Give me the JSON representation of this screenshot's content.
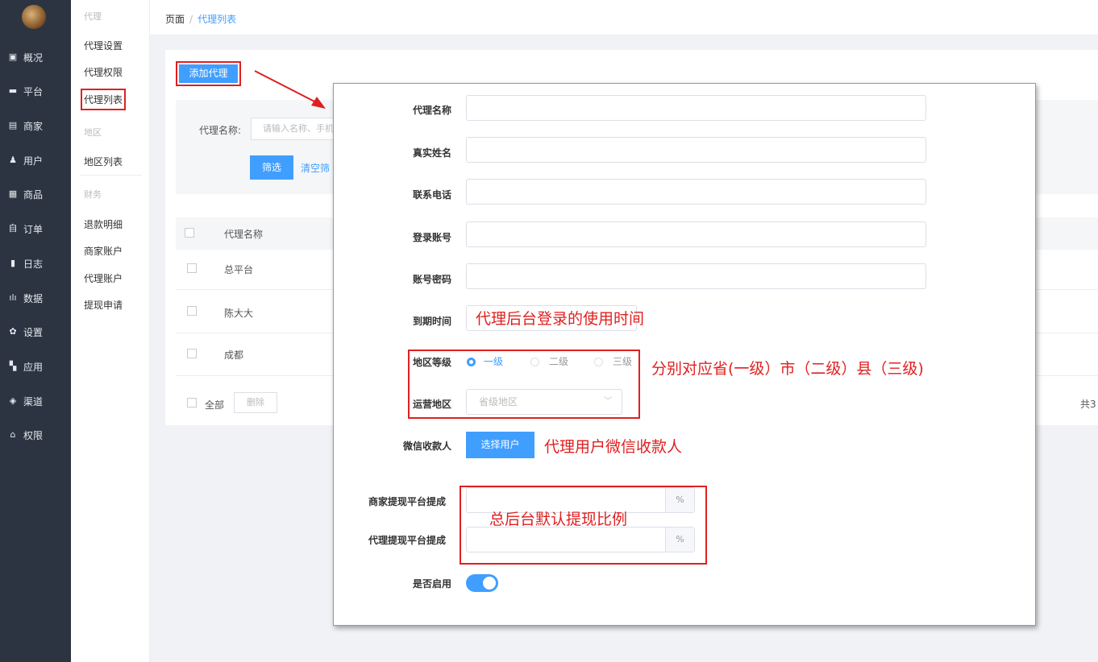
{
  "sidebar": {
    "items": [
      {
        "label": "概况",
        "icon": "monitor-icon",
        "glyph": "▣"
      },
      {
        "label": "平台",
        "icon": "platform-icon",
        "glyph": "▬"
      },
      {
        "label": "商家",
        "icon": "store-icon",
        "glyph": "▤"
      },
      {
        "label": "用户",
        "icon": "user-icon",
        "glyph": "♟"
      },
      {
        "label": "商品",
        "icon": "goods-icon",
        "glyph": "▦"
      },
      {
        "label": "订单",
        "icon": "order-icon",
        "glyph": "自"
      },
      {
        "label": "日志",
        "icon": "log-icon",
        "glyph": "▮"
      },
      {
        "label": "数据",
        "icon": "chart-icon",
        "glyph": "ılı"
      },
      {
        "label": "设置",
        "icon": "gear-icon",
        "glyph": "✿"
      },
      {
        "label": "应用",
        "icon": "apps-icon",
        "glyph": "▚"
      },
      {
        "label": "渠道",
        "icon": "channel-icon",
        "glyph": "◈"
      },
      {
        "label": "权限",
        "icon": "lock-icon",
        "glyph": "⌂"
      }
    ]
  },
  "submenu": {
    "group1": "代理",
    "agent_settings": "代理设置",
    "agent_permissions": "代理权限",
    "agent_list": "代理列表",
    "group2": "地区",
    "region_list": "地区列表",
    "group3": "财务",
    "refund_detail": "退款明细",
    "merchant_account": "商家账户",
    "agent_account": "代理账户",
    "withdraw_request": "提现申请"
  },
  "breadcrumb": {
    "root": "页面",
    "separator": "/",
    "current": "代理列表"
  },
  "toolbar": {
    "add_agent": "添加代理"
  },
  "filter": {
    "name_label": "代理名称:",
    "name_placeholder": "请输入名称、手机",
    "filter_button": "筛选",
    "clear_link": "清空筛"
  },
  "table": {
    "header_name": "代理名称",
    "rows": [
      "总平台",
      "陈大大",
      "成都"
    ],
    "select_all": "全部",
    "delete_button": "删除",
    "total_text": "共3"
  },
  "form": {
    "agent_name": "代理名称",
    "real_name": "真实姓名",
    "phone": "联系电话",
    "login_account": "登录账号",
    "account_password": "账号密码",
    "expire_time": "到期时间",
    "region_level": "地区等级",
    "level_options": [
      "一级",
      "二级",
      "三级"
    ],
    "selected_level": "一级",
    "operate_region": "运营地区",
    "region_placeholder": "省级地区",
    "wechat_payee": "微信收款人",
    "choose_user": "选择用户",
    "merchant_commission": "商家提现平台提成",
    "agent_commission": "代理提现平台提成",
    "percent_suffix": "%",
    "enabled_label": "是否启用",
    "enabled": true
  },
  "annotations": {
    "expire_note": "代理后台登录的使用时间",
    "level_note": "分别对应省(一级）市（二级）县（三级)",
    "payee_note": "代理用户微信收款人",
    "commission_note": "总后台默认提现比例"
  },
  "colors": {
    "accent": "#409eff",
    "annotation": "#e02020",
    "sidebar": "#2b3440"
  }
}
